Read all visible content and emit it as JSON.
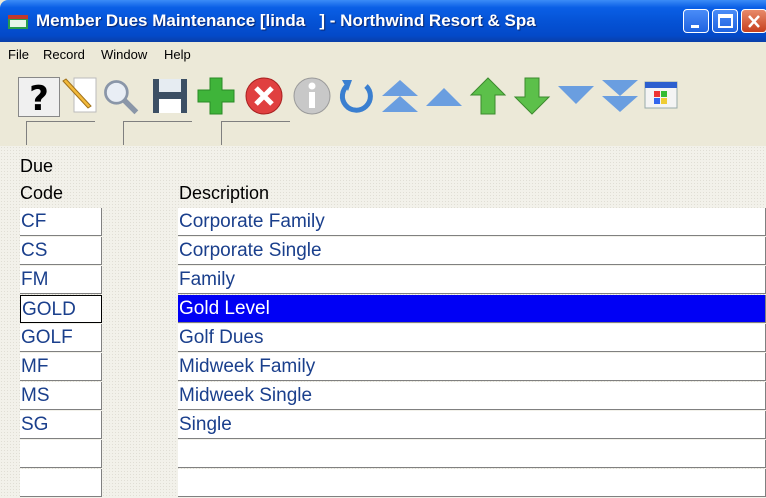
{
  "window": {
    "title": "Member Dues Maintenance [linda   ] - Northwind Resort & Spa"
  },
  "menu": [
    "File",
    "Record",
    "Window",
    "Help"
  ],
  "toolbar": {
    "buttons": [
      "help-icon",
      "new-record-icon",
      "find-icon",
      "save-icon",
      "add-icon",
      "delete-icon",
      "info-icon",
      "refresh-icon",
      "first-record-icon",
      "previous-page-icon",
      "previous-record-icon",
      "next-record-icon",
      "next-page-icon",
      "last-record-icon",
      "windows-icon"
    ]
  },
  "grid": {
    "header_code_line1": "Due",
    "header_code_line2": "Code",
    "header_description": "Description",
    "rows": [
      {
        "code": "CF",
        "description": "Corporate Family"
      },
      {
        "code": "CS",
        "description": "Corporate Single"
      },
      {
        "code": "FM",
        "description": "Family"
      },
      {
        "code": "GOLD",
        "description": "Gold Level",
        "selected": true
      },
      {
        "code": "GOLF",
        "description": "Golf Dues"
      },
      {
        "code": "MF",
        "description": "Midweek Family"
      },
      {
        "code": "MS",
        "description": "Midweek Single"
      },
      {
        "code": "SG",
        "description": "Single"
      },
      {
        "code": "",
        "description": ""
      },
      {
        "code": "",
        "description": ""
      }
    ]
  },
  "colors": {
    "titlebar": "#0553d6",
    "selection": "#0000f5",
    "cell_text": "#1a3f8c"
  }
}
